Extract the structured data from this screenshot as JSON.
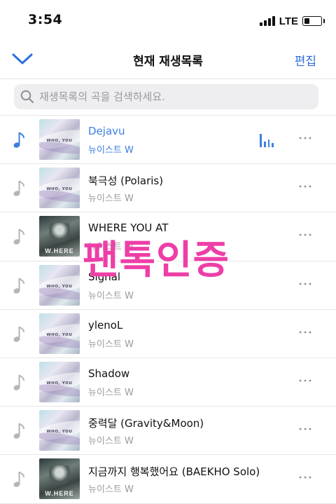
{
  "status_bar": {
    "time": "3:54",
    "network": "LTE"
  },
  "nav": {
    "title": "현재 재생목록",
    "edit_label": "편집",
    "back_icon": "chevron-down-icon"
  },
  "search": {
    "placeholder": "재생목록의 곡을 검색하세요.",
    "value": ""
  },
  "colors": {
    "accent": "#3d7fe0",
    "watermark": "#ee3ea7",
    "secondary_text": "#9b9b9b"
  },
  "tracks": [
    {
      "title": "Dejavu",
      "artist": "뉴이스트 W",
      "playing": true,
      "album": "WHO, YOU"
    },
    {
      "title": "북극성 (Polaris)",
      "artist": "뉴이스트 W",
      "playing": false,
      "album": "WHO, YOU"
    },
    {
      "title": "WHERE YOU AT",
      "artist": "뉴이스트 W",
      "playing": false,
      "album": "WHERE"
    },
    {
      "title": "Signal",
      "artist": "뉴이스트 W",
      "playing": false,
      "album": "WHO, YOU"
    },
    {
      "title": "ylenoL",
      "artist": "뉴이스트 W",
      "playing": false,
      "album": "WHO, YOU"
    },
    {
      "title": "Shadow",
      "artist": "뉴이스트 W",
      "playing": false,
      "album": "WHO, YOU"
    },
    {
      "title": "중력달 (Gravity&Moon)",
      "artist": "뉴이스트 W",
      "playing": false,
      "album": "WHO, YOU"
    },
    {
      "title": "지금까지 행복했어요 (BAEKHO Solo)",
      "artist": "뉴이스트 W",
      "playing": false,
      "album": "WHERE"
    }
  ],
  "album_art_text": {
    "WHO, YOU": "WHO, YOU",
    "WHERE": "W.HERE"
  },
  "watermark": {
    "text": "팬톡인증"
  }
}
